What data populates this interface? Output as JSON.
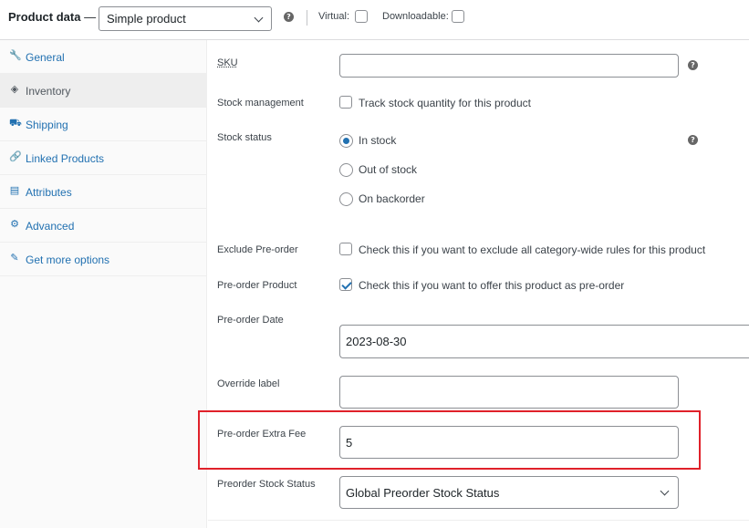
{
  "header": {
    "title": "Product data",
    "dash": " —",
    "product_type": "Simple product",
    "virtual_label": "Virtual:",
    "downloadable_label": "Downloadable:",
    "virtual_checked": false,
    "downloadable_checked": false
  },
  "tabs": [
    {
      "label": "General",
      "icon": "wrench-icon",
      "glyph": "🔧",
      "active": false
    },
    {
      "label": "Inventory",
      "icon": "tag-icon",
      "glyph": "◈",
      "active": true
    },
    {
      "label": "Shipping",
      "icon": "truck-icon",
      "glyph": "⛟",
      "active": false
    },
    {
      "label": "Linked Products",
      "icon": "link-icon",
      "glyph": "🔗",
      "active": false
    },
    {
      "label": "Attributes",
      "icon": "list-icon",
      "glyph": "▤",
      "active": false
    },
    {
      "label": "Advanced",
      "icon": "gear-icon",
      "glyph": "⚙",
      "active": false
    },
    {
      "label": "Get more options",
      "icon": "plugin-icon",
      "glyph": "✎",
      "active": false
    }
  ],
  "fields": {
    "sku": {
      "label": "SKU",
      "value": ""
    },
    "stock_management": {
      "label": "Stock management",
      "checkbox_text": "Track stock quantity for this product",
      "checked": false
    },
    "stock_status": {
      "label": "Stock status",
      "options": [
        "In stock",
        "Out of stock",
        "On backorder"
      ],
      "selected": "In stock"
    },
    "exclude_preorder": {
      "label": "Exclude Pre-order",
      "checkbox_text": "Check this if you want to exclude all category-wide rules for this product",
      "checked": false
    },
    "preorder_product": {
      "label": "Pre-order Product",
      "checkbox_text": "Check this if you want to offer this product as pre-order",
      "checked": true
    },
    "preorder_date": {
      "label": "Pre-order Date",
      "value": "2023-08-30"
    },
    "override_label": {
      "label": "Override label",
      "value": ""
    },
    "preorder_extra_fee": {
      "label": "Pre-order Extra Fee",
      "value": "5"
    },
    "preorder_stock_status": {
      "label": "Preorder Stock Status",
      "value": "Global Preorder Stock Status"
    }
  },
  "colors": {
    "link": "#2271b1",
    "highlight": "#e0212a",
    "border": "#8c8f94"
  }
}
